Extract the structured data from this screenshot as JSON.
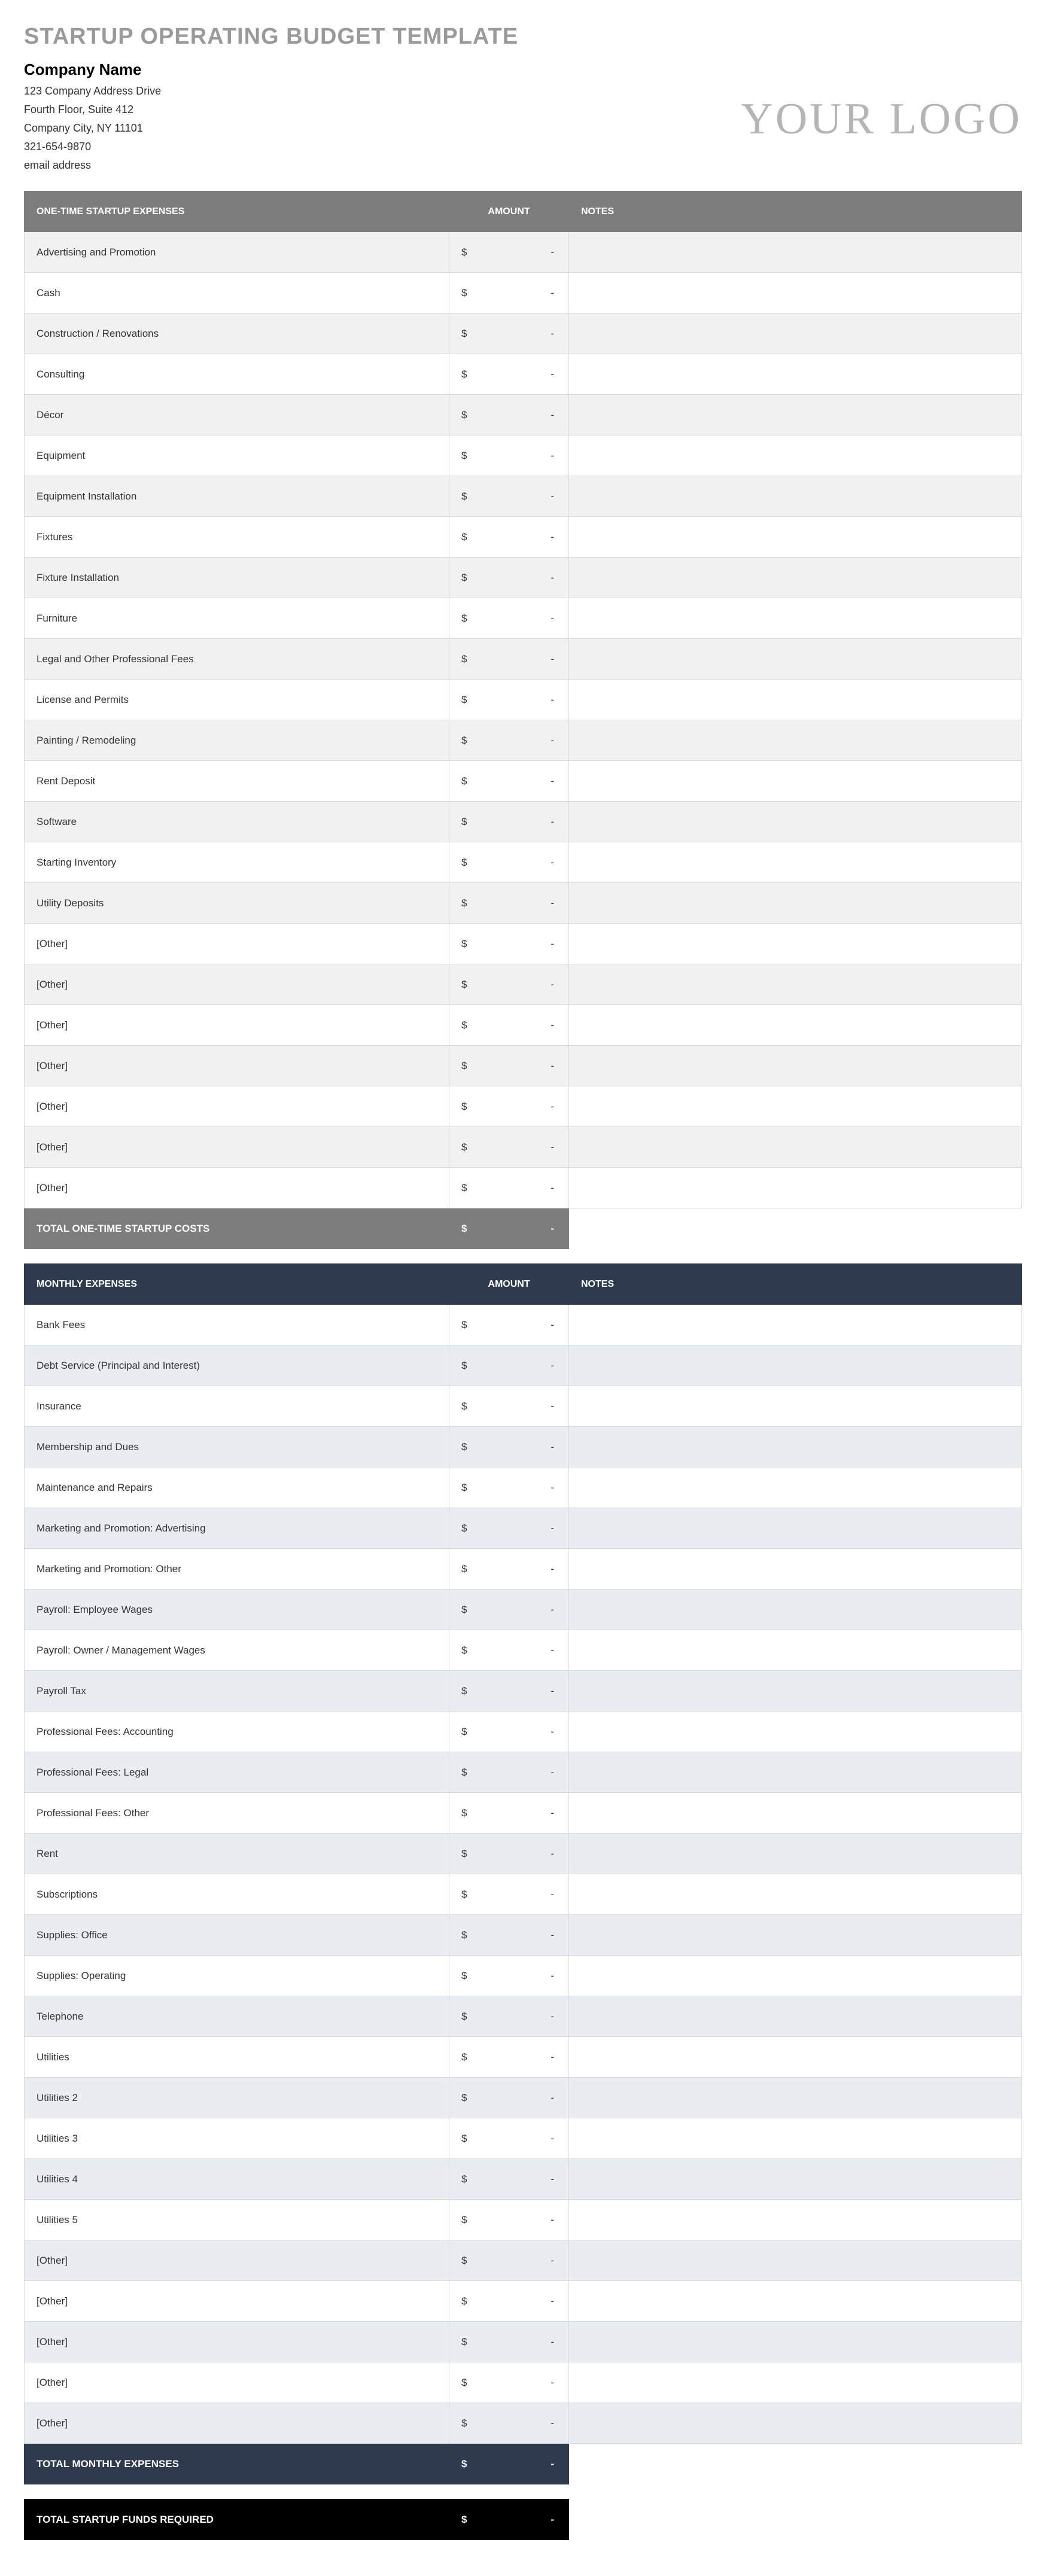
{
  "title": "STARTUP OPERATING BUDGET TEMPLATE",
  "company": {
    "name": "Company Name",
    "addr1": "123 Company Address Drive",
    "addr2": "Fourth Floor, Suite 412",
    "city": "Company City, NY  11101",
    "phone": "321-654-9870",
    "email": "email address"
  },
  "logo_text": "YOUR LOGO",
  "currency": "$",
  "dash": "-",
  "onetime": {
    "head_name": "ONE-TIME STARTUP EXPENSES",
    "head_amt": "AMOUNT",
    "head_notes": "NOTES",
    "total_label": "TOTAL ONE-TIME STARTUP COSTS",
    "total_value": "-",
    "rows": [
      {
        "name": "Advertising and Promotion",
        "amount": "-",
        "notes": ""
      },
      {
        "name": "Cash",
        "amount": "-",
        "notes": ""
      },
      {
        "name": "Construction / Renovations",
        "amount": "-",
        "notes": ""
      },
      {
        "name": "Consulting",
        "amount": "-",
        "notes": ""
      },
      {
        "name": "Décor",
        "amount": "-",
        "notes": ""
      },
      {
        "name": "Equipment",
        "amount": "-",
        "notes": ""
      },
      {
        "name": "Equipment Installation",
        "amount": "-",
        "notes": ""
      },
      {
        "name": "Fixtures",
        "amount": "-",
        "notes": ""
      },
      {
        "name": "Fixture Installation",
        "amount": "-",
        "notes": ""
      },
      {
        "name": "Furniture",
        "amount": "-",
        "notes": ""
      },
      {
        "name": "Legal and Other Professional Fees",
        "amount": "-",
        "notes": ""
      },
      {
        "name": "License and Permits",
        "amount": "-",
        "notes": ""
      },
      {
        "name": "Painting / Remodeling",
        "amount": "-",
        "notes": ""
      },
      {
        "name": "Rent Deposit",
        "amount": "-",
        "notes": ""
      },
      {
        "name": "Software",
        "amount": "-",
        "notes": ""
      },
      {
        "name": "Starting Inventory",
        "amount": "-",
        "notes": ""
      },
      {
        "name": "Utility Deposits",
        "amount": "-",
        "notes": ""
      },
      {
        "name": "[Other]",
        "amount": "-",
        "notes": ""
      },
      {
        "name": "[Other]",
        "amount": "-",
        "notes": ""
      },
      {
        "name": "[Other]",
        "amount": "-",
        "notes": ""
      },
      {
        "name": "[Other]",
        "amount": "-",
        "notes": ""
      },
      {
        "name": "[Other]",
        "amount": "-",
        "notes": ""
      },
      {
        "name": "[Other]",
        "amount": "-",
        "notes": ""
      },
      {
        "name": "[Other]",
        "amount": "-",
        "notes": ""
      }
    ]
  },
  "monthly": {
    "head_name": "MONTHLY EXPENSES",
    "head_amt": "AMOUNT",
    "head_notes": "NOTES",
    "total_label": "TOTAL MONTHLY EXPENSES",
    "total_value": "-",
    "rows": [
      {
        "name": "Bank Fees",
        "amount": "-",
        "notes": ""
      },
      {
        "name": "Debt Service (Principal and Interest)",
        "amount": "-",
        "notes": ""
      },
      {
        "name": "Insurance",
        "amount": "-",
        "notes": ""
      },
      {
        "name": "Membership and Dues",
        "amount": "-",
        "notes": ""
      },
      {
        "name": "Maintenance and Repairs",
        "amount": "-",
        "notes": ""
      },
      {
        "name": "Marketing and Promotion: Advertising",
        "amount": "-",
        "notes": ""
      },
      {
        "name": "Marketing and Promotion: Other",
        "amount": "-",
        "notes": ""
      },
      {
        "name": "Payroll: Employee Wages",
        "amount": "-",
        "notes": ""
      },
      {
        "name": "Payroll: Owner / Management Wages",
        "amount": "-",
        "notes": ""
      },
      {
        "name": "Payroll Tax",
        "amount": "-",
        "notes": ""
      },
      {
        "name": "Professional Fees: Accounting",
        "amount": "-",
        "notes": ""
      },
      {
        "name": "Professional Fees: Legal",
        "amount": "-",
        "notes": ""
      },
      {
        "name": "Professional Fees: Other",
        "amount": "-",
        "notes": ""
      },
      {
        "name": "Rent",
        "amount": "-",
        "notes": ""
      },
      {
        "name": "Subscriptions",
        "amount": "-",
        "notes": ""
      },
      {
        "name": "Supplies: Office",
        "amount": "-",
        "notes": ""
      },
      {
        "name": "Supplies: Operating",
        "amount": "-",
        "notes": ""
      },
      {
        "name": "Telephone",
        "amount": "-",
        "notes": ""
      },
      {
        "name": "Utilities",
        "amount": "-",
        "notes": ""
      },
      {
        "name": "Utilities 2",
        "amount": "-",
        "notes": ""
      },
      {
        "name": "Utilities 3",
        "amount": "-",
        "notes": ""
      },
      {
        "name": "Utilities 4",
        "amount": "-",
        "notes": ""
      },
      {
        "name": "Utilities 5",
        "amount": "-",
        "notes": ""
      },
      {
        "name": "[Other]",
        "amount": "-",
        "notes": ""
      },
      {
        "name": "[Other]",
        "amount": "-",
        "notes": ""
      },
      {
        "name": "[Other]",
        "amount": "-",
        "notes": ""
      },
      {
        "name": "[Other]",
        "amount": "-",
        "notes": ""
      },
      {
        "name": "[Other]",
        "amount": "-",
        "notes": ""
      }
    ]
  },
  "grand": {
    "label": "TOTAL STARTUP FUNDS REQUIRED",
    "value": "-"
  }
}
